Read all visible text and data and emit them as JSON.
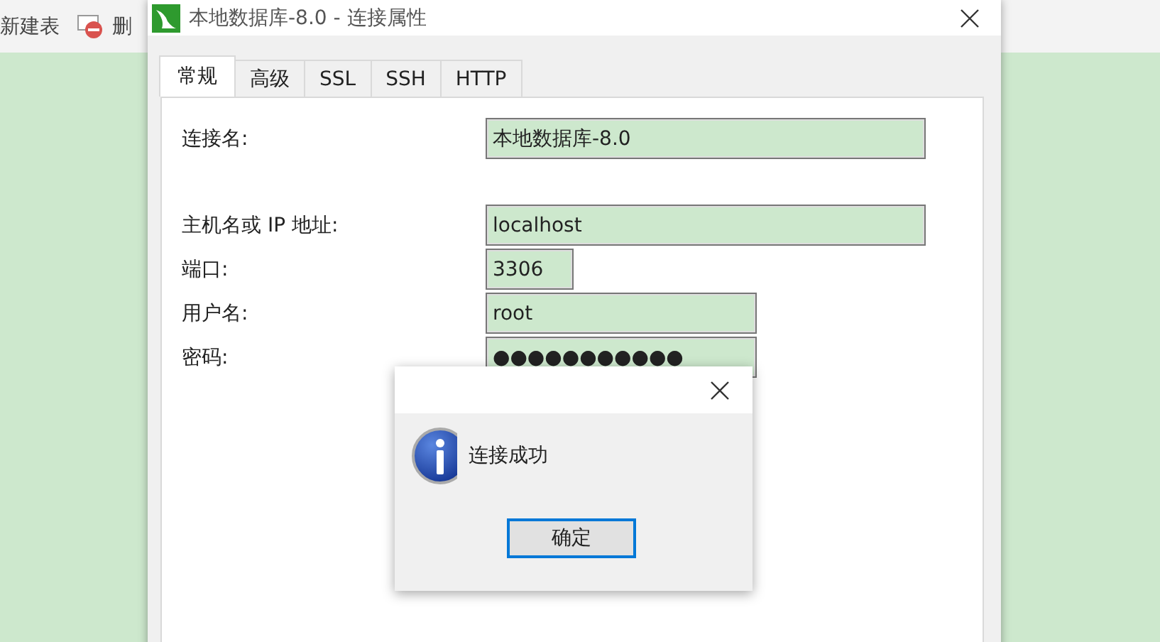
{
  "background_app": {
    "toolbar": [
      {
        "label": "新建表",
        "kind": "table"
      },
      {
        "label": "删",
        "kind": "delete"
      }
    ]
  },
  "window": {
    "title": "本地数据库-8.0 - 连接属性"
  },
  "tabs": [
    {
      "label": "常规",
      "selected": true
    },
    {
      "label": "高级",
      "selected": false
    },
    {
      "label": "SSL",
      "selected": false
    },
    {
      "label": "SSH",
      "selected": false
    },
    {
      "label": "HTTP",
      "selected": false
    }
  ],
  "field_groups": [
    [
      {
        "label": "连接名:",
        "value": "本地数据库-8.0"
      }
    ],
    [
      {
        "label": "主机名或 IP 地址:",
        "value": "localhost"
      },
      {
        "label": "端口:",
        "value": "3306"
      },
      {
        "label": "用户名:",
        "value": "root"
      },
      {
        "label": "密码:",
        "value": "●●●●●●●●●●●"
      }
    ]
  ],
  "message_box": {
    "message": "连接成功",
    "button": "确定"
  }
}
